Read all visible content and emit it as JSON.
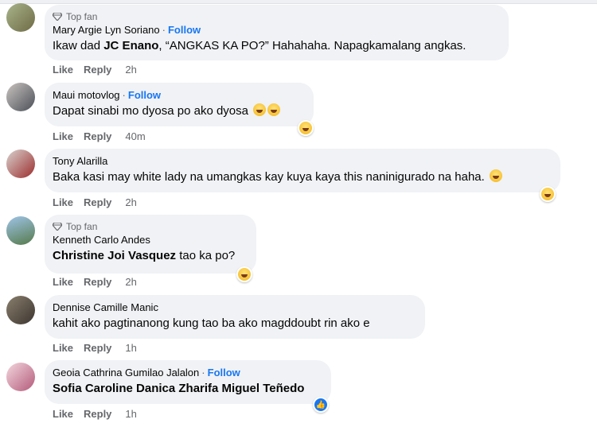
{
  "comments": [
    {
      "top_fan": "Top fan",
      "name": "Mary Argie Lyn Soriano",
      "follow": "Follow",
      "mention": "JC Enano",
      "text_before": "Ikaw dad ",
      "text_after": ", “ANGKAS KA PO?” Hahahaha. Napagkamalang angkas.",
      "like": "Like",
      "reply": "Reply",
      "time": "2h"
    },
    {
      "name": "Maui motovlog",
      "follow": "Follow",
      "text": "Dapat sinabi mo dyosa po ako dyosa",
      "like": "Like",
      "reply": "Reply",
      "time": "40m",
      "reaction": "haha-icon"
    },
    {
      "name": "Tony Alarilla",
      "text": "Baka kasi may white lady na umangkas kay kuya kaya this naninigurado na haha.",
      "like": "Like",
      "reply": "Reply",
      "time": "2h",
      "reaction": "haha-icon"
    },
    {
      "top_fan": "Top fan",
      "name": "Kenneth Carlo Andes",
      "mention": "Christine Joi Vasquez",
      "text_after": " tao ka po?",
      "like": "Like",
      "reply": "Reply",
      "time": "2h",
      "reaction": "haha-icon"
    },
    {
      "name": "Dennise Camille Manic",
      "text": "kahit ako pagtinanong kung tao ba ako magddoubt rin ako e",
      "like": "Like",
      "reply": "Reply",
      "time": "1h"
    },
    {
      "name": "Geoia Cathrina Gumilao Jalalon",
      "follow": "Follow",
      "mention": "Sofia Caroline Danica Zharifa Miguel Teñedo",
      "like": "Like",
      "reply": "Reply",
      "time": "1h",
      "reaction": "like-icon"
    }
  ]
}
